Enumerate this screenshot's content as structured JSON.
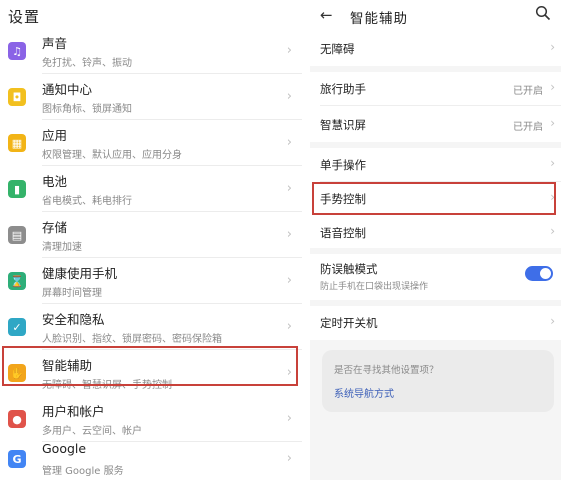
{
  "left": {
    "title": "设置",
    "items": [
      {
        "title": "声音",
        "sub": "免打扰、铃声、振动",
        "color": "#8a63e6",
        "icon": "speaker-icon",
        "glyph": "♫"
      },
      {
        "title": "通知中心",
        "sub": "图标角标、锁屏通知",
        "color": "#f2c01f",
        "icon": "bell-icon",
        "glyph": "◘"
      },
      {
        "title": "应用",
        "sub": "权限管理、默认应用、应用分身",
        "color": "#f2b416",
        "icon": "apps-icon",
        "glyph": "▦"
      },
      {
        "title": "电池",
        "sub": "省电模式、耗电排行",
        "color": "#34b36a",
        "icon": "battery-icon",
        "glyph": "▮"
      },
      {
        "title": "存储",
        "sub": "清理加速",
        "color": "#8d8d8d",
        "icon": "storage-icon",
        "glyph": "▤"
      },
      {
        "title": "健康使用手机",
        "sub": "屏幕时间管理",
        "color": "#2eae79",
        "icon": "hourglass-icon",
        "glyph": "⌛"
      },
      {
        "title": "安全和隐私",
        "sub": "人脸识别、指纹、锁屏密码、密码保险箱",
        "color": "#2fa7c5",
        "icon": "shield-icon",
        "glyph": "✓"
      },
      {
        "title": "智能辅助",
        "sub": "无障碍、智慧识屏、手势控制",
        "color": "#f2a51b",
        "icon": "hand-icon",
        "glyph": "✋"
      },
      {
        "title": "用户和帐户",
        "sub": "多用户、云空间、帐户",
        "color": "#e0534a",
        "icon": "user-icon",
        "glyph": "●"
      },
      {
        "title": "Google",
        "sub": "管理 Google 服务",
        "color": "#4285f4",
        "icon": "google-icon",
        "glyph": "G"
      }
    ]
  },
  "right": {
    "back_icon": "back-arrow-icon",
    "title": "智能辅助",
    "search_icon": "search-icon",
    "group1": [
      {
        "label": "无障碍"
      }
    ],
    "group2": [
      {
        "label": "旅行助手",
        "value": "已开启"
      },
      {
        "label": "智慧识屏",
        "value": "已开启"
      }
    ],
    "group3": [
      {
        "label": "单手操作"
      },
      {
        "label": "手势控制"
      },
      {
        "label": "语音控制"
      }
    ],
    "group4": {
      "label": "防误触模式",
      "sub": "防止手机在口袋出现误操作",
      "toggle_on": true
    },
    "group5": [
      {
        "label": "定时开关机"
      }
    ],
    "tip": {
      "question": "是否在寻找其他设置项？",
      "link": "系统导航方式"
    }
  },
  "colors": {
    "highlight": "#c8413a",
    "accent": "#3e6ee8",
    "link": "#3c5fb8"
  }
}
